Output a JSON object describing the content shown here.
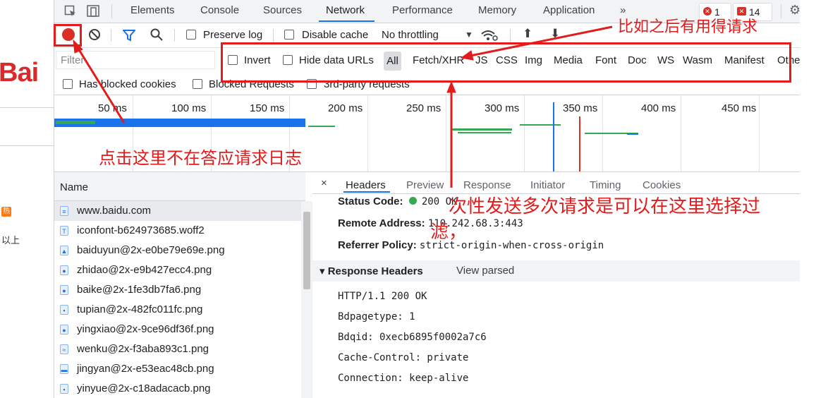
{
  "page": {
    "logo": "Bai",
    "hot_badge": "热",
    "above_text": "以上"
  },
  "devtools": {
    "tabs": [
      "Elements",
      "Console",
      "Sources",
      "Network",
      "Performance",
      "Memory",
      "Application",
      "»"
    ],
    "error_count": "1",
    "warning_count": "14",
    "toolbar": {
      "preserve_log": "Preserve log",
      "disable_cache": "Disable cache",
      "throttling": "No throttling"
    },
    "filter": {
      "placeholder": "Filter",
      "invert": "Invert",
      "hide_data_urls": "Hide data URLs",
      "types": [
        "All",
        "Fetch/XHR",
        "JS",
        "CSS",
        "Img",
        "Media",
        "Font",
        "Doc",
        "WS",
        "Wasm",
        "Manifest",
        "Othe"
      ]
    },
    "blocked": {
      "has_blocked_cookies": "Has blocked cookies",
      "blocked_requests": "Blocked Requests",
      "third_party": "3rd-party requests"
    },
    "timeline_ticks": [
      "50 ms",
      "100 ms",
      "150 ms",
      "200 ms",
      "250 ms",
      "300 ms",
      "350 ms",
      "400 ms",
      "450 ms"
    ],
    "name_header": "Name",
    "requests": [
      {
        "name": "www.baidu.com",
        "icon": "document-icon"
      },
      {
        "name": "iconfont-b624973685.woff2",
        "icon": "font-icon"
      },
      {
        "name": "baiduyun@2x-e0be79e69e.png",
        "icon": "image-icon"
      },
      {
        "name": "zhidao@2x-e9b427ecc4.png",
        "icon": "image-icon"
      },
      {
        "name": "baike@2x-1fe3db7fa6.png",
        "icon": "image-icon"
      },
      {
        "name": "tupian@2x-482fc011fc.png",
        "icon": "image-icon"
      },
      {
        "name": "yingxiao@2x-9ce96df36f.png",
        "icon": "image-icon"
      },
      {
        "name": "wenku@2x-f3aba893c1.png",
        "icon": "image-icon"
      },
      {
        "name": "jingyan@2x-e53eac48cb.png",
        "icon": "image-icon"
      },
      {
        "name": "yinyue@2x-c18adacacb.png",
        "icon": "image-icon"
      }
    ],
    "detail_tabs": [
      "×",
      "Headers",
      "Preview",
      "Response",
      "Initiator",
      "Timing",
      "Cookies"
    ],
    "general": {
      "status_code_label": "Status Code:",
      "status_code_value": "200 OK",
      "remote_address_label": "Remote Address:",
      "remote_address_value": "110.242.68.3:443",
      "referrer_policy_label": "Referrer Policy:",
      "referrer_policy_value": "strict-origin-when-cross-origin"
    },
    "response_headers": {
      "title": "▾ Response Headers",
      "view_parsed": "View parsed",
      "lines": [
        "HTTP/1.1 200 OK",
        "Bdpagetype: 1",
        "Bdqid: 0xecb6895f0002a7c6",
        "Cache-Control: private",
        "Connection: keep-alive"
      ]
    }
  },
  "annotations": {
    "top_right": "比如之后有用得请求",
    "record_note": "点击这里不在答应请求日志",
    "filter_note_line1": "次性发送多次请求是可以在这里选择过",
    "filter_note_line2": "滤，"
  },
  "colors": {
    "annotation_red": "#e31b1b",
    "record_red": "#d93025",
    "accent_blue": "#1a73e8",
    "status_green": "#34a853"
  }
}
